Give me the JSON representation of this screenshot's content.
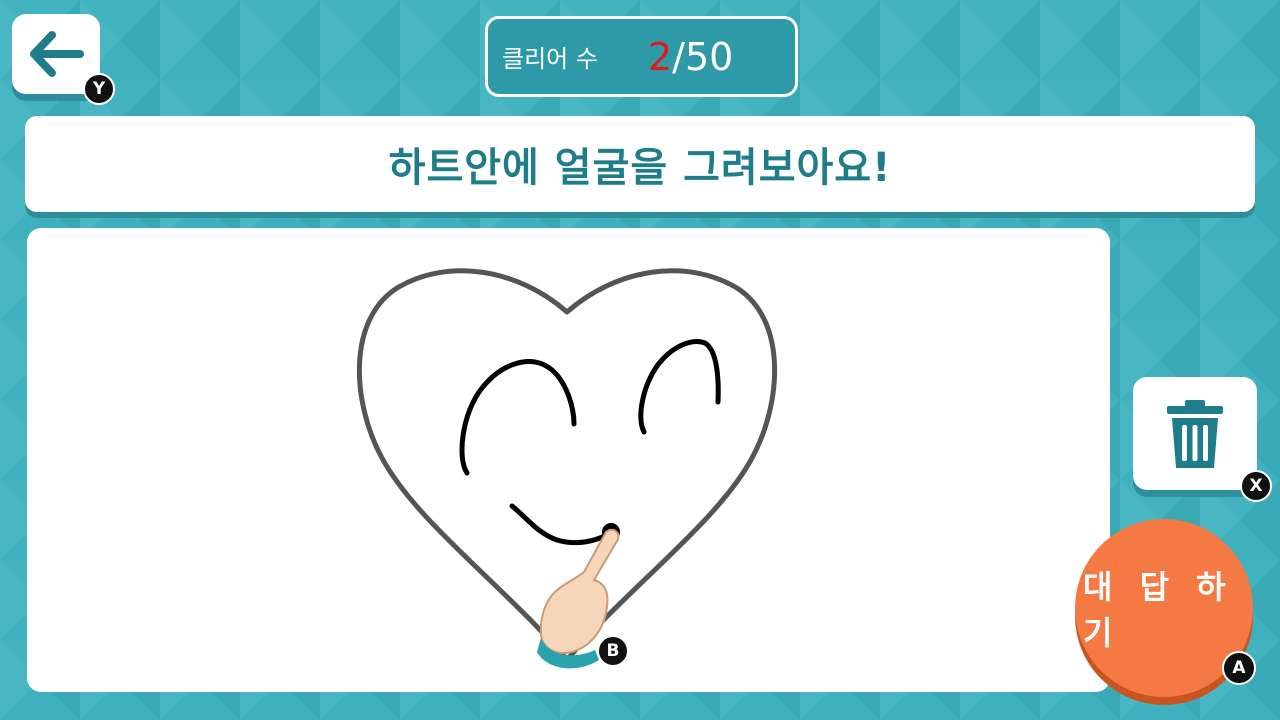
{
  "header": {
    "back_hint": "Y",
    "counter_label": "클리어 수",
    "counter_current": "2",
    "counter_total": "/50"
  },
  "prompt": {
    "text": "하트안에 얼굴을 그려보아요!"
  },
  "canvas": {
    "pointer_hint": "B",
    "pen_color": "#000000",
    "outline_color": "#555555"
  },
  "actions": {
    "clear_hint": "X",
    "answer_label": "대 답 하 기",
    "answer_hint": "A"
  },
  "colors": {
    "background": "#3fb0bd",
    "accent": "#1e7d88",
    "answer_button": "#f57942",
    "counter_highlight": "#e01a1a"
  },
  "icons": [
    "arrow-left-icon",
    "trash-icon",
    "pointing-hand-icon"
  ]
}
